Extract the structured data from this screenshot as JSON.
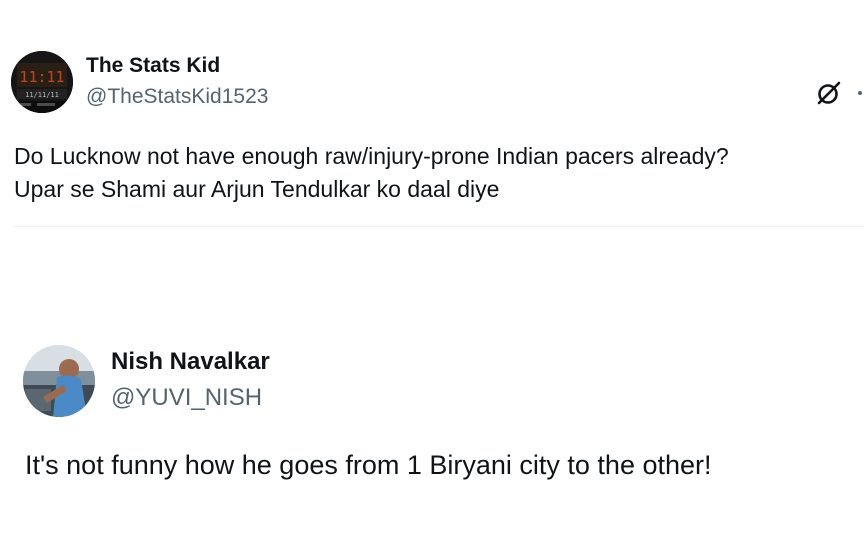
{
  "tweets": [
    {
      "display_name": "The Stats Kid",
      "handle": "@TheStatsKid1523",
      "avatar_icon": "scoreboard-avatar",
      "avatar_clock": "11:11",
      "avatar_score": "11/11/11",
      "text": "Do Lucknow not have enough raw/injury-prone Indian pacers already?\nUpar se Shami aur Arjun Tendulkar ko daal diye"
    },
    {
      "display_name": "Nish Navalkar",
      "handle": "@YUVI_NISH",
      "avatar_icon": "stadium-selfie-avatar",
      "text": "It's not funny how he goes from 1 Biryani city to the other!"
    }
  ],
  "actions": {
    "grok_icon": "grok-slash-icon",
    "more_icon": "more-options-icon"
  },
  "colors": {
    "text_primary": "#0f1419",
    "text_secondary": "#536471",
    "divider": "#eff3f4"
  }
}
